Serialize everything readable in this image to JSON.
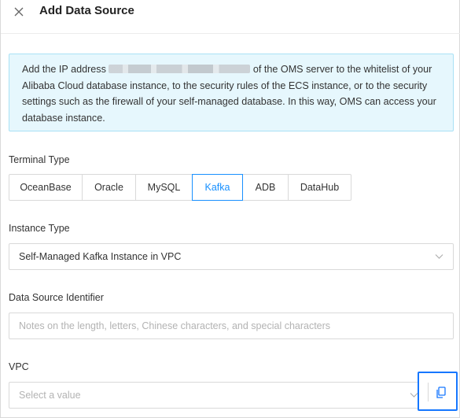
{
  "header": {
    "title": "Add Data Source",
    "close_icon": "close-icon"
  },
  "notice": {
    "text_before": "Add the IP address",
    "text_after": "of the OMS server to the whitelist of your Alibaba Cloud database instance, to the security rules of the ECS instance, or to the security settings such as the firewall of your self-managed database. In this way, OMS can access your database instance."
  },
  "terminal_type": {
    "label": "Terminal Type",
    "options": [
      "OceanBase",
      "Oracle",
      "MySQL",
      "Kafka",
      "ADB",
      "DataHub"
    ],
    "selected": "Kafka"
  },
  "instance_type": {
    "label": "Instance Type",
    "value": "Self-Managed Kafka Instance in VPC"
  },
  "data_source_identifier": {
    "label": "Data Source Identifier",
    "placeholder": "Notes on the length, letters, Chinese characters, and special characters"
  },
  "vpc": {
    "label": "VPC",
    "placeholder": "Select a value",
    "action_icon": "copy-icon"
  },
  "colors": {
    "accent": "#1890ff",
    "highlight_border": "#1677ff",
    "notice_bg": "#e6f7fd",
    "notice_border": "#a9e1f5"
  }
}
